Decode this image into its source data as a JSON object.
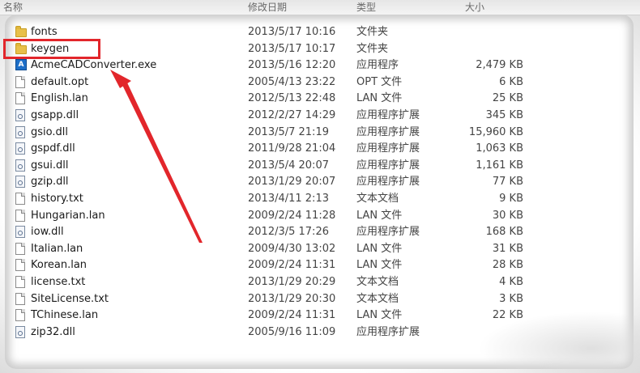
{
  "columns": {
    "name": "名称",
    "date": "修改日期",
    "type": "类型",
    "size": "大小"
  },
  "files": [
    {
      "name": "fonts",
      "date": "2013/5/17 10:16",
      "type": "文件夹",
      "size": "",
      "icon": "folder-icon"
    },
    {
      "name": "keygen",
      "date": "2013/5/17 10:17",
      "type": "文件夹",
      "size": "",
      "icon": "folder-icon"
    },
    {
      "name": "AcmeCADConverter.exe",
      "date": "2013/5/16 12:20",
      "type": "应用程序",
      "size": "2,479 KB",
      "icon": "exe-icon"
    },
    {
      "name": "default.opt",
      "date": "2005/4/13 23:22",
      "type": "OPT 文件",
      "size": "6 KB",
      "icon": "file-icon"
    },
    {
      "name": "English.lan",
      "date": "2012/5/13 22:48",
      "type": "LAN 文件",
      "size": "25 KB",
      "icon": "file-icon"
    },
    {
      "name": "gsapp.dll",
      "date": "2012/2/27 14:29",
      "type": "应用程序扩展",
      "size": "345 KB",
      "icon": "dll-icon"
    },
    {
      "name": "gsio.dll",
      "date": "2013/5/7 21:19",
      "type": "应用程序扩展",
      "size": "15,960 KB",
      "icon": "dll-icon"
    },
    {
      "name": "gspdf.dll",
      "date": "2011/9/28 21:04",
      "type": "应用程序扩展",
      "size": "1,063 KB",
      "icon": "dll-icon"
    },
    {
      "name": "gsui.dll",
      "date": "2013/5/4 20:07",
      "type": "应用程序扩展",
      "size": "1,161 KB",
      "icon": "dll-icon"
    },
    {
      "name": "gzip.dll",
      "date": "2013/1/29 20:07",
      "type": "应用程序扩展",
      "size": "77 KB",
      "icon": "dll-icon"
    },
    {
      "name": "history.txt",
      "date": "2013/4/11 2:13",
      "type": "文本文档",
      "size": "9 KB",
      "icon": "file-icon"
    },
    {
      "name": "Hungarian.lan",
      "date": "2009/2/24 11:28",
      "type": "LAN 文件",
      "size": "30 KB",
      "icon": "file-icon"
    },
    {
      "name": "iow.dll",
      "date": "2012/3/5 17:26",
      "type": "应用程序扩展",
      "size": "168 KB",
      "icon": "dll-icon"
    },
    {
      "name": "Italian.lan",
      "date": "2009/4/30 13:02",
      "type": "LAN 文件",
      "size": "31 KB",
      "icon": "file-icon"
    },
    {
      "name": "Korean.lan",
      "date": "2009/2/24 11:31",
      "type": "LAN 文件",
      "size": "28 KB",
      "icon": "file-icon"
    },
    {
      "name": "license.txt",
      "date": "2013/1/29 20:29",
      "type": "文本文档",
      "size": "4 KB",
      "icon": "file-icon"
    },
    {
      "name": "SiteLicense.txt",
      "date": "2013/1/29 20:30",
      "type": "文本文档",
      "size": "3 KB",
      "icon": "file-icon"
    },
    {
      "name": "TChinese.lan",
      "date": "2009/2/24 11:31",
      "type": "LAN 文件",
      "size": "22 KB",
      "icon": "file-icon"
    },
    {
      "name": "zip32.dll",
      "date": "2005/9/16 11:09",
      "type": "应用程序扩展",
      "size": "",
      "icon": "dll-icon"
    }
  ],
  "annotation": {
    "color": "#e2262b",
    "target": "keygen"
  }
}
